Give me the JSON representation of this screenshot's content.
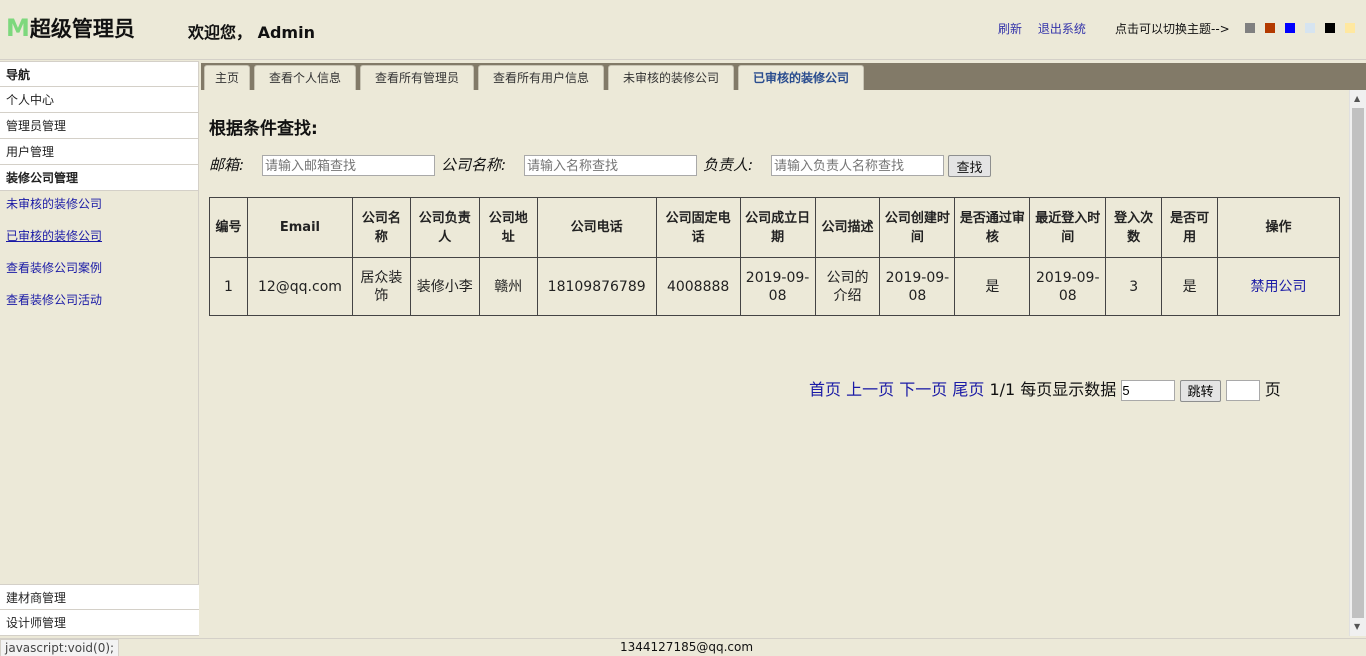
{
  "header": {
    "logo_mark": "M",
    "logo_text": "超级管理员",
    "welcome": "欢迎您， Admin",
    "refresh": "刷新",
    "logout": "退出系统",
    "theme_tip": "点击可以切换主题-->",
    "theme_colors": [
      "#808080",
      "#b33a00",
      "#0000ff",
      "#d6e4f0",
      "#000000",
      "#ffe8a0"
    ]
  },
  "sidebar": {
    "head": "导航",
    "items_top": [
      "个人中心",
      "管理员管理",
      "用户管理",
      "装修公司管理"
    ],
    "sub_items": [
      "未审核的装修公司",
      "已审核的装修公司",
      "查看装修公司案例",
      "查看装修公司活动"
    ],
    "items_bottom": [
      "建材商管理",
      "设计师管理"
    ]
  },
  "tabs": [
    "主页",
    "查看个人信息",
    "查看所有管理员",
    "查看所有用户信息",
    "未审核的装修公司",
    "已审核的装修公司"
  ],
  "search": {
    "title": "根据条件查找:",
    "email_label": "邮箱:",
    "email_placeholder": "请输入邮箱查找",
    "company_label": "公司名称:",
    "company_placeholder": "请输入名称查找",
    "owner_label": "负责人:",
    "owner_placeholder": "请输入负责人名称查找",
    "button": "查找"
  },
  "table": {
    "headers": [
      "编号",
      "Email",
      "公司名称",
      "公司负责人",
      "公司地址",
      "公司电话",
      "公司固定电话",
      "公司成立日期",
      "公司描述",
      "公司创建时间",
      "是否通过审核",
      "最近登入时间",
      "登入次数",
      "是否可用",
      "操作"
    ],
    "rows": [
      [
        "1",
        "12@qq.com",
        "居众装饰",
        "装修小李",
        "赣州",
        "18109876789",
        "4008888",
        "2019-09-08",
        "公司的介绍",
        "2019-09-08",
        "是",
        "2019-09-08",
        "3",
        "是",
        "禁用公司"
      ]
    ]
  },
  "pager": {
    "first": "首页",
    "prev": "上一页",
    "next": "下一页",
    "last": "尾页",
    "page_info": "1/1",
    "per_page_label": "每页显示数据",
    "per_page_value": "5",
    "jump_button": "跳转",
    "page_suffix": "页"
  },
  "status": {
    "left": "javascript:void(0);",
    "center": "1344127185@qq.com"
  }
}
